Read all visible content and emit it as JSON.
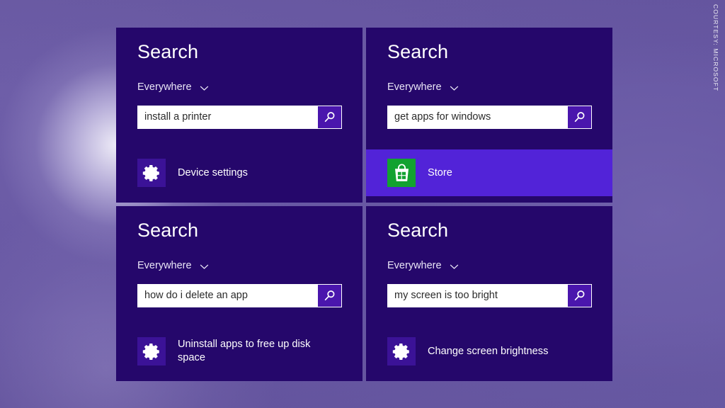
{
  "watermark": {
    "text": "COURTESY: MICROSOFT"
  },
  "colors": {
    "panel_background": "#25076b",
    "highlight_row": "#5223d8",
    "search_button": "#4a16ad",
    "gear_tile": "#3b1297",
    "store_tile": "#12a230",
    "input_background": "#ffffff",
    "input_text": "#2b2b2b",
    "desktop": "#6a5aa6"
  },
  "panels": [
    {
      "heading": "Search",
      "scope": "Everywhere",
      "scope_icon": "chevron-down-icon",
      "query": "install a printer",
      "query_placeholder": "Search",
      "search_icon": "search-icon",
      "result": {
        "label": "Device settings",
        "icon": "gear-icon",
        "icon_kind": "gear",
        "highlighted": false,
        "wrap": false
      }
    },
    {
      "heading": "Search",
      "scope": "Everywhere",
      "scope_icon": "chevron-down-icon",
      "query": "get apps for windows",
      "query_placeholder": "Search",
      "search_icon": "search-icon",
      "result": {
        "label": "Store",
        "icon": "windows-store-icon",
        "icon_kind": "store",
        "highlighted": true,
        "wrap": false
      }
    },
    {
      "heading": "Search",
      "scope": "Everywhere",
      "scope_icon": "chevron-down-icon",
      "query": "how do i delete an app",
      "query_placeholder": "Search",
      "search_icon": "search-icon",
      "result": {
        "label": "Uninstall apps to free up disk space",
        "icon": "gear-icon",
        "icon_kind": "gear",
        "highlighted": false,
        "wrap": true
      }
    },
    {
      "heading": "Search",
      "scope": "Everywhere",
      "scope_icon": "chevron-down-icon",
      "query": "my screen is too bright",
      "query_placeholder": "Search",
      "search_icon": "search-icon",
      "result": {
        "label": "Change screen brightness",
        "icon": "gear-icon",
        "icon_kind": "gear",
        "highlighted": false,
        "wrap": false
      }
    }
  ]
}
